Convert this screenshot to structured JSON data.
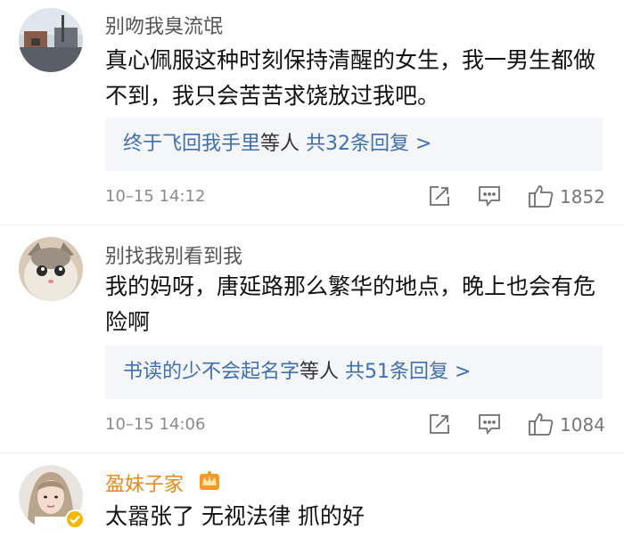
{
  "comments": [
    {
      "username": "别吻我臭流氓",
      "content": "真心佩服这种时刻保持清醒的女生，我一男生都做不到，我只会苦苦求饶放过我吧。",
      "reply_user": "终于飞回我手里",
      "reply_suffix": "等人",
      "reply_count": "共32条回复 >",
      "time": "10–15 14:12",
      "likes": "1852"
    },
    {
      "username": "别找我别看到我",
      "content": "我的妈呀，唐延路那么繁华的地点，晚上也会有危险啊",
      "reply_user": "书读的少不会起名字",
      "reply_suffix": "等人",
      "reply_count": "共51条回复 >",
      "time": "10–15 14:06",
      "likes": "1084"
    },
    {
      "username": "盈妹子家",
      "content": "太嚣张了 无视法律 抓的好"
    }
  ],
  "colors": {
    "link": "#3e6fb0",
    "vip_name": "#e8871b",
    "reply_bg": "#f5f6f9"
  }
}
